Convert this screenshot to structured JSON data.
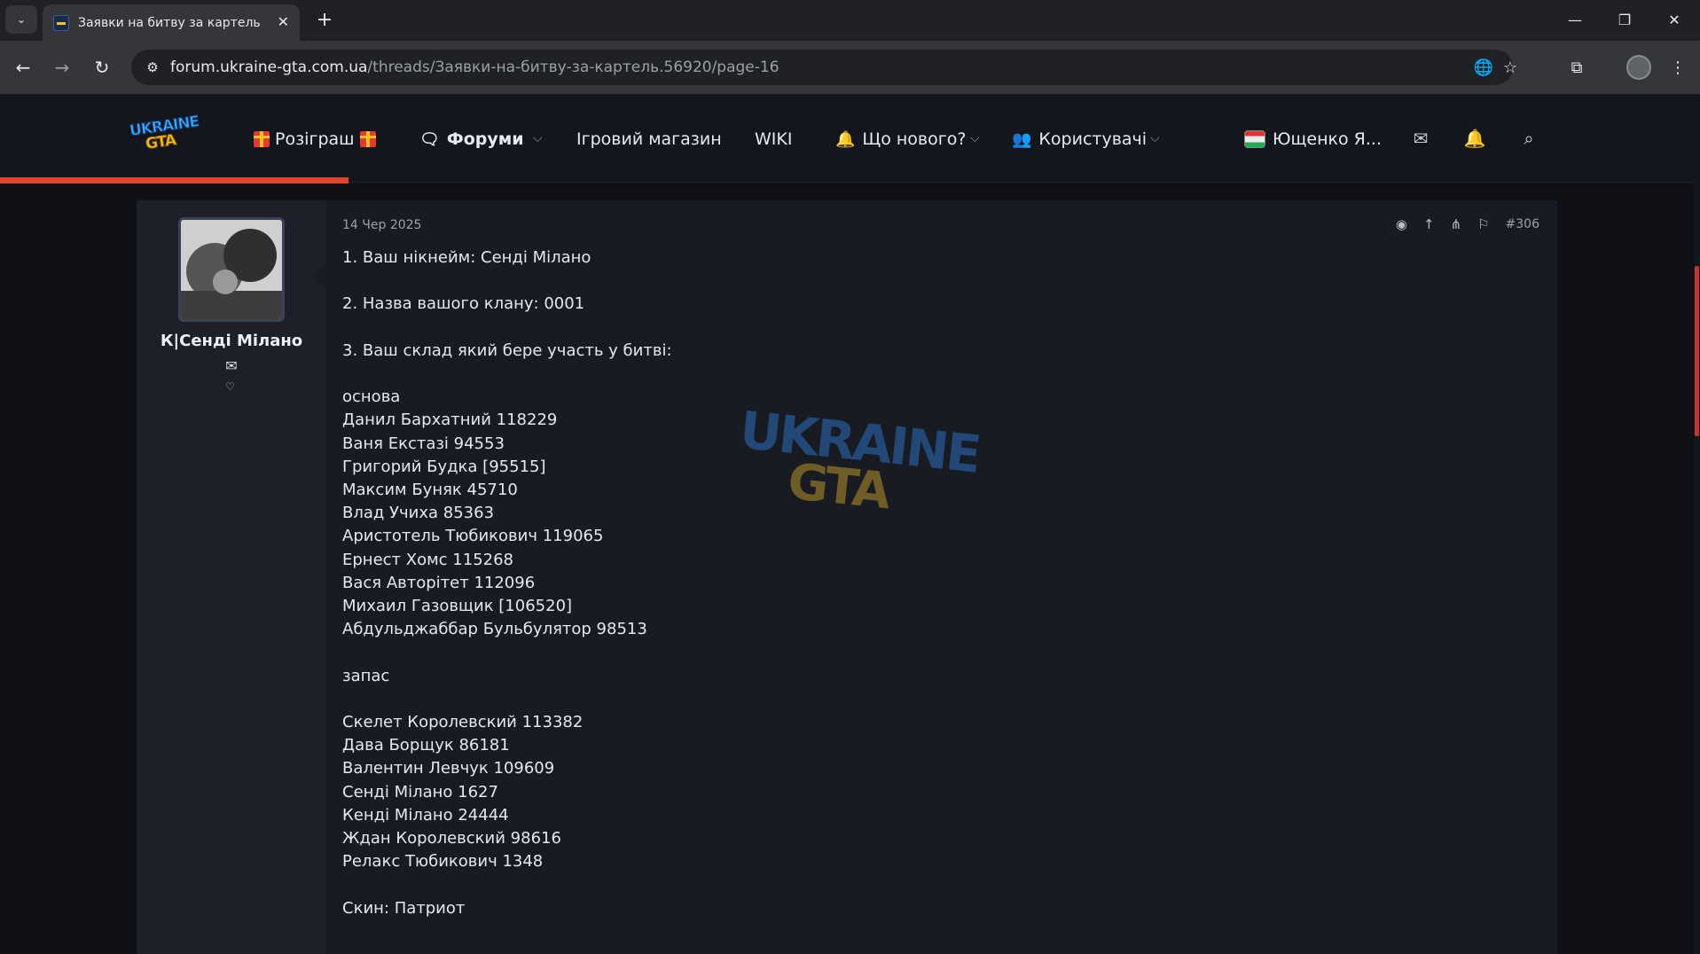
{
  "browser": {
    "tab_title": "Заявки на битву за картель | С",
    "tab_close": "✕",
    "new_tab": "+",
    "url_host": "forum.ukraine-gta.com.ua",
    "url_path": "/threads/Заявки-на-битву-за-картель.56920/page-16",
    "controls": {
      "minimize": "—",
      "restore": "❐",
      "close": "✕"
    }
  },
  "header": {
    "logo_line1": "UKRAINE",
    "logo_line2": "GTA",
    "nav": [
      {
        "label": "Розіграш"
      },
      {
        "label": "Форуми"
      },
      {
        "label": "Ігровий магазин"
      },
      {
        "label": "WIKI"
      },
      {
        "label": "Що нового?"
      },
      {
        "label": "Користувачі"
      }
    ],
    "user_name": "Ющенко Я...",
    "progress_fraction": 0.205
  },
  "post": {
    "author": "К|Сенді Мілано",
    "date": "14 Чер 2025",
    "number": "#306",
    "lines": [
      "1. Ваш нікнейм: Сенді Мілано",
      "",
      "2. Назва вашого клану: 0001",
      "",
      "3. Ваш склад який бере участь у битві:",
      "",
      "основа",
      "Данил Бархатний 118229",
      "Ваня Екстазі 94553",
      "Григорий Будка [95515]",
      "Максим Буняк 45710",
      "Влад Учиха 85363",
      "Аристотель Тюбикович 119065",
      "Ернест Хомс 115268",
      "Вася Авторітет 112096",
      "Михаил Газовщик [106520]",
      "Абдульджаббар Бульбулятор 98513",
      "",
      "запас",
      "",
      "Скелет Королевский 113382",
      "Дава Борщук 86181",
      "Валентин Левчук 109609",
      "Сенді Мілано 1627",
      "Кенді Мілано 24444",
      "Ждан Королевский 98616",
      "Релакс Тюбикович 1348",
      "",
      "Скин: Патриот"
    ],
    "watermark_line1": "UKRAINE",
    "watermark_line2": "GTA"
  }
}
